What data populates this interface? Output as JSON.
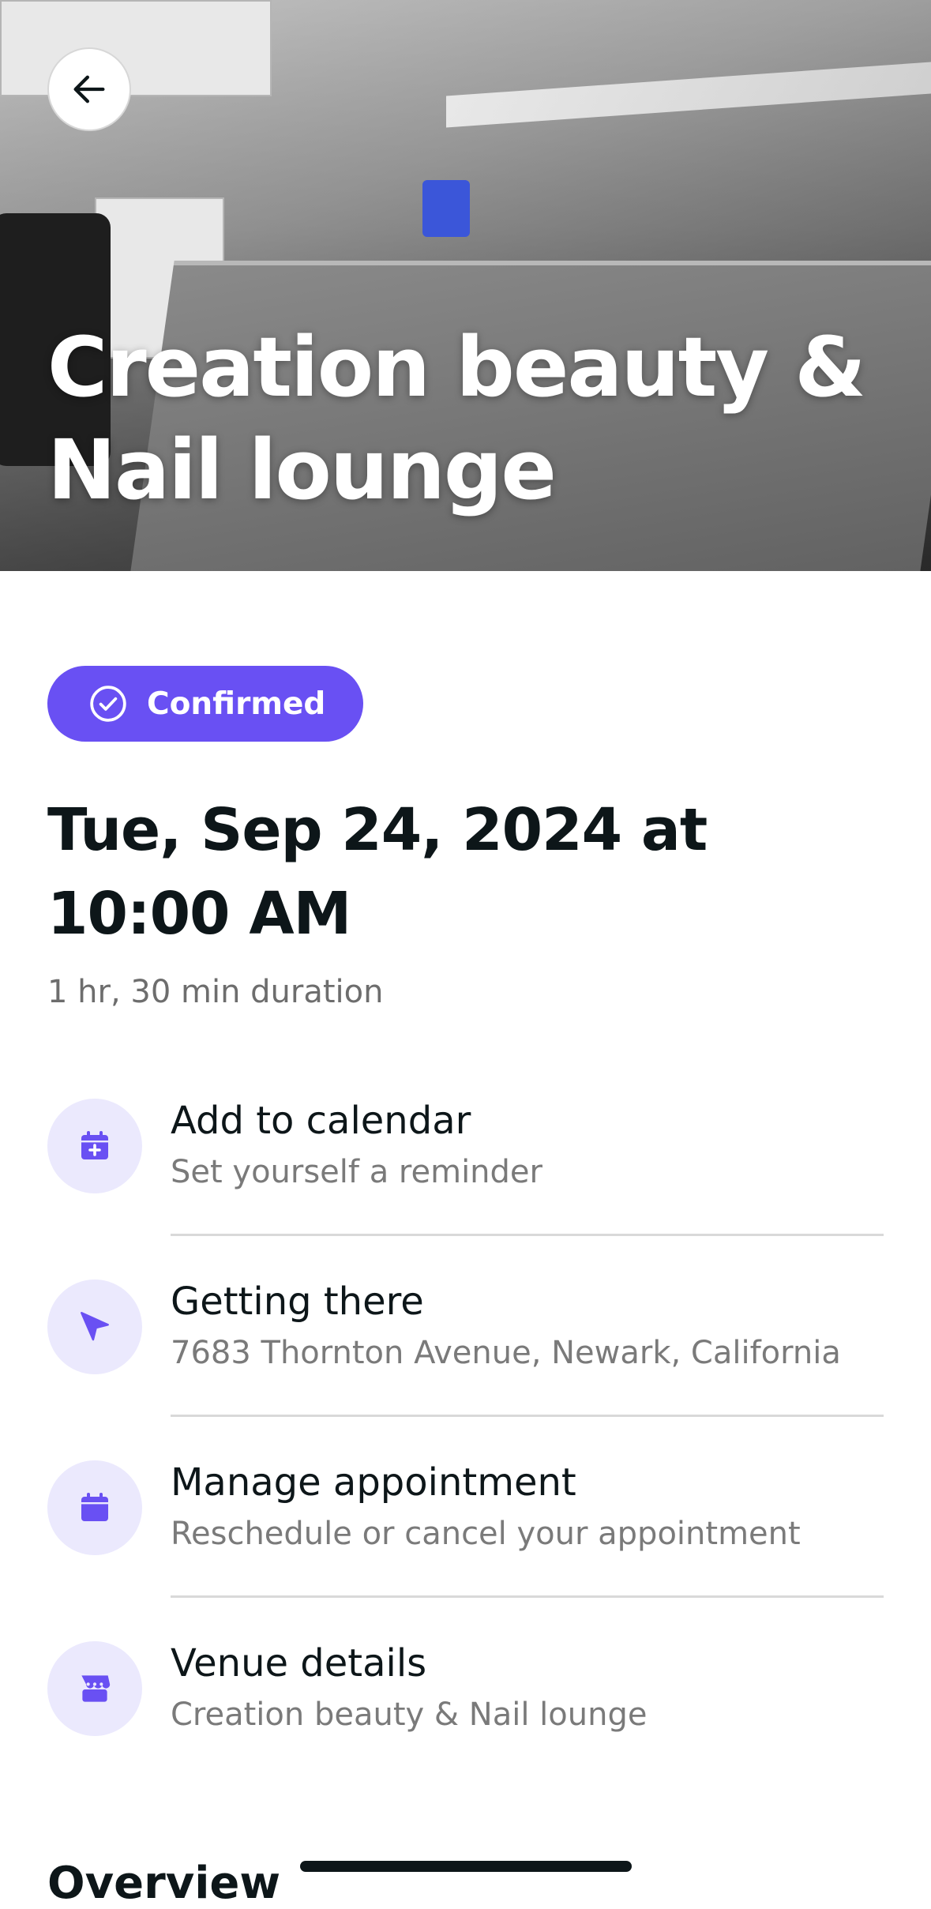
{
  "hero": {
    "title": "Creation beauty & Nail lounge"
  },
  "header": {
    "back_icon": "arrow-left-icon"
  },
  "status": {
    "label": "Confirmed",
    "icon": "check-circle-icon",
    "color": "#6950f3"
  },
  "appointment": {
    "datetime": "Tue, Sep 24, 2024 at 10:00 AM",
    "duration": "1 hr, 30 min duration"
  },
  "actions": [
    {
      "title": "Add to calendar",
      "subtitle": "Set yourself a reminder",
      "icon": "calendar-plus-icon"
    },
    {
      "title": "Getting there",
      "subtitle": "7683 Thornton Avenue, Newark, California",
      "icon": "navigation-arrow-icon"
    },
    {
      "title": "Manage appointment",
      "subtitle": "Reschedule or cancel your appointment",
      "icon": "calendar-icon"
    },
    {
      "title": "Venue details",
      "subtitle": "Creation beauty & Nail lounge",
      "icon": "storefront-icon"
    }
  ],
  "section": {
    "overview_title": "Overview"
  },
  "colors": {
    "accent": "#6950f3",
    "icon_bg": "#ebe9fd",
    "text_primary": "#0d1619",
    "text_secondary": "#7a7a7a"
  }
}
